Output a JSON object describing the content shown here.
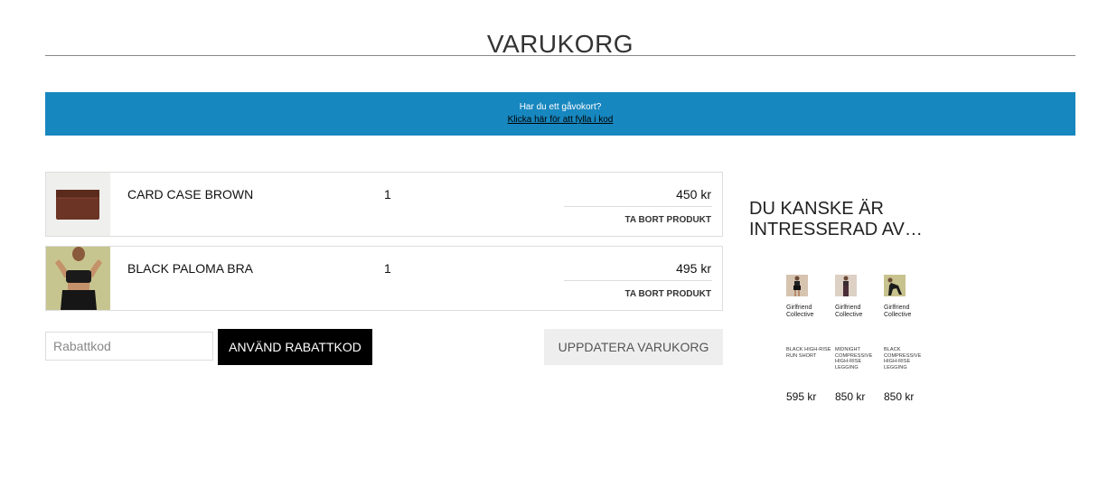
{
  "header": {
    "title": "VARUKORG"
  },
  "gift_banner": {
    "question": "Har du ett gåvokort?",
    "link_text": "Klicka här för att fylla i kod",
    "color": "#1787bf"
  },
  "cart": {
    "items": [
      {
        "name": "CARD CASE BROWN",
        "quantity": "1",
        "price": "450 kr",
        "remove_label": "TA BORT PRODUKT"
      },
      {
        "name": "BLACK PALOMA BRA",
        "quantity": "1",
        "price": "495 kr",
        "remove_label": "TA BORT PRODUKT"
      }
    ],
    "coupon": {
      "placeholder": "Rabattkod",
      "value": ""
    },
    "apply_label": "ANVÄND RABATTKOD",
    "update_label": "UPPDATERA VARUKORG"
  },
  "recommendations": {
    "title": "DU KANSKE ÄR INTRESSERAD AV…",
    "items": [
      {
        "brand": "Girlfriend Collective",
        "name": "BLACK HIGH-RISE RUN SHORT",
        "price": "595 kr"
      },
      {
        "brand": "Girlfriend Collective",
        "name": "MIDNIGHT COMPRESSIVE HIGH-RISE LEGGING",
        "price": "850 kr"
      },
      {
        "brand": "Girlfriend Collective",
        "name": "BLACK COMPRESSIVE HIGH-RISE LEGGING",
        "price": "850 kr"
      }
    ]
  }
}
